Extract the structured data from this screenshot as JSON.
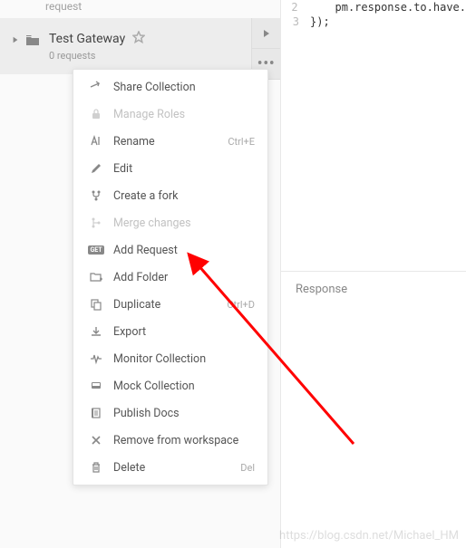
{
  "sidebar": {
    "prev_item": "request",
    "collection": {
      "title": "Test Gateway",
      "subtitle": "0 requests"
    }
  },
  "menu": {
    "items": [
      {
        "icon": "share-icon",
        "label": "Share Collection",
        "shortcut": "",
        "disabled": false
      },
      {
        "icon": "lock-icon",
        "label": "Manage Roles",
        "shortcut": "",
        "disabled": true
      },
      {
        "icon": "rename-icon",
        "label": "Rename",
        "shortcut": "Ctrl+E",
        "disabled": false
      },
      {
        "icon": "edit-icon",
        "label": "Edit",
        "shortcut": "",
        "disabled": false
      },
      {
        "icon": "fork-icon",
        "label": "Create a fork",
        "shortcut": "",
        "disabled": false
      },
      {
        "icon": "merge-icon",
        "label": "Merge changes",
        "shortcut": "",
        "disabled": true
      },
      {
        "icon": "get-icon",
        "label": "Add Request",
        "shortcut": "",
        "disabled": false
      },
      {
        "icon": "folder-add-icon",
        "label": "Add Folder",
        "shortcut": "",
        "disabled": false
      },
      {
        "icon": "duplicate-icon",
        "label": "Duplicate",
        "shortcut": "Ctrl+D",
        "disabled": false
      },
      {
        "icon": "export-icon",
        "label": "Export",
        "shortcut": "",
        "disabled": false
      },
      {
        "icon": "monitor-icon",
        "label": "Monitor Collection",
        "shortcut": "",
        "disabled": false
      },
      {
        "icon": "mock-icon",
        "label": "Mock Collection",
        "shortcut": "",
        "disabled": false
      },
      {
        "icon": "publish-icon",
        "label": "Publish Docs",
        "shortcut": "",
        "disabled": false
      },
      {
        "icon": "remove-icon",
        "label": "Remove from workspace",
        "shortcut": "",
        "disabled": false
      },
      {
        "icon": "delete-icon",
        "label": "Delete",
        "shortcut": "Del",
        "disabled": false
      }
    ]
  },
  "code": {
    "lines": [
      {
        "num": "2",
        "text": "    pm.response.to.have."
      },
      {
        "num": "3",
        "text": "});"
      }
    ]
  },
  "response": {
    "title": "Response"
  },
  "watermark": "https://blog.csdn.net/Michael_HM"
}
